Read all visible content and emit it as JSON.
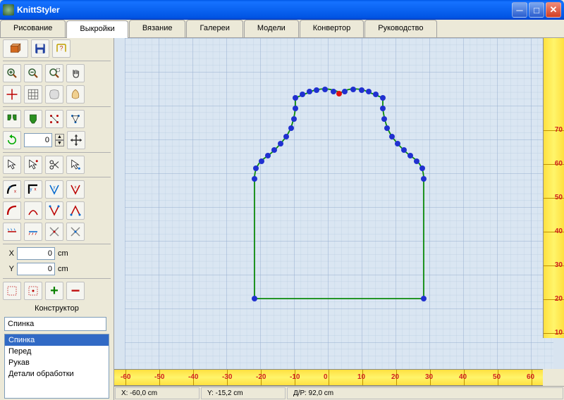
{
  "window": {
    "title": "KnittStyler"
  },
  "tabs": [
    "Рисование",
    "Выкройки",
    "Вязание",
    "Галереи",
    "Модели",
    "Конвертор",
    "Руководство"
  ],
  "active_tab": 1,
  "rotation_value": "0",
  "xy": {
    "x_label": "X",
    "x_value": "0",
    "x_unit": "cm",
    "y_label": "Y",
    "y_value": "0",
    "y_unit": "cm"
  },
  "constructor_label": "Конструктор",
  "current_part": "Спинка",
  "parts": [
    "Спинка",
    "Перед",
    "Рукав",
    "Детали обработки"
  ],
  "selected_part_index": 0,
  "status": {
    "x": "X: -60,0 cm",
    "y": "Y: -15,2 cm",
    "d": "Д/Р: 92,0 cm"
  },
  "ruler_h": [
    -60,
    -50,
    -40,
    -30,
    -20,
    -10,
    0,
    10,
    20,
    30,
    40,
    50,
    60
  ],
  "ruler_v": [
    10,
    20,
    30,
    40,
    50,
    60,
    70
  ],
  "colors": {
    "grid": "#b0c4de",
    "grid_major": "#95afd0",
    "pattern_line": "#0b8a0b",
    "node": "#2020e0",
    "node_hl": "#e01010"
  },
  "icons": {
    "box": "box-icon",
    "save": "save-icon",
    "help": "help-icon",
    "zoom_in": "zoom-in-icon",
    "zoom_out": "zoom-out-icon",
    "zoom_region": "zoom-region-icon",
    "pan": "pan-icon",
    "crosshair": "crosshair-icon",
    "grid": "grid-icon",
    "snap": "snap-icon",
    "shell": "shell-icon",
    "pieces1": "pieces-green-icon",
    "pieces2": "pieces-green2-icon",
    "nodes_pts": "node-points-icon",
    "nodes_disp": "node-disp-icon",
    "rotate": "rotate-icon",
    "move": "move-handle-icon",
    "arrow": "arrow-icon",
    "arrow_pts": "arrow-points-icon",
    "scissors": "scissors-icon",
    "arrow_pt": "arrow-point-icon",
    "yx1": "handle-yx1-icon",
    "yx2": "handle-yx2-icon",
    "yx3": "handle-yx3-icon",
    "yx4": "handle-yx4-icon",
    "h1": "handle-1-icon",
    "h2": "handle-2-icon",
    "h3": "handle-3-icon",
    "h4": "handle-4-icon",
    "h5": "handle-5-icon",
    "h6": "handle-6-icon",
    "h7": "handle-7-icon",
    "h8": "handle-8-icon",
    "sel": "marquee-icon",
    "selpt": "marquee-point-icon",
    "plus": "plus-icon",
    "minus": "minus-icon"
  }
}
